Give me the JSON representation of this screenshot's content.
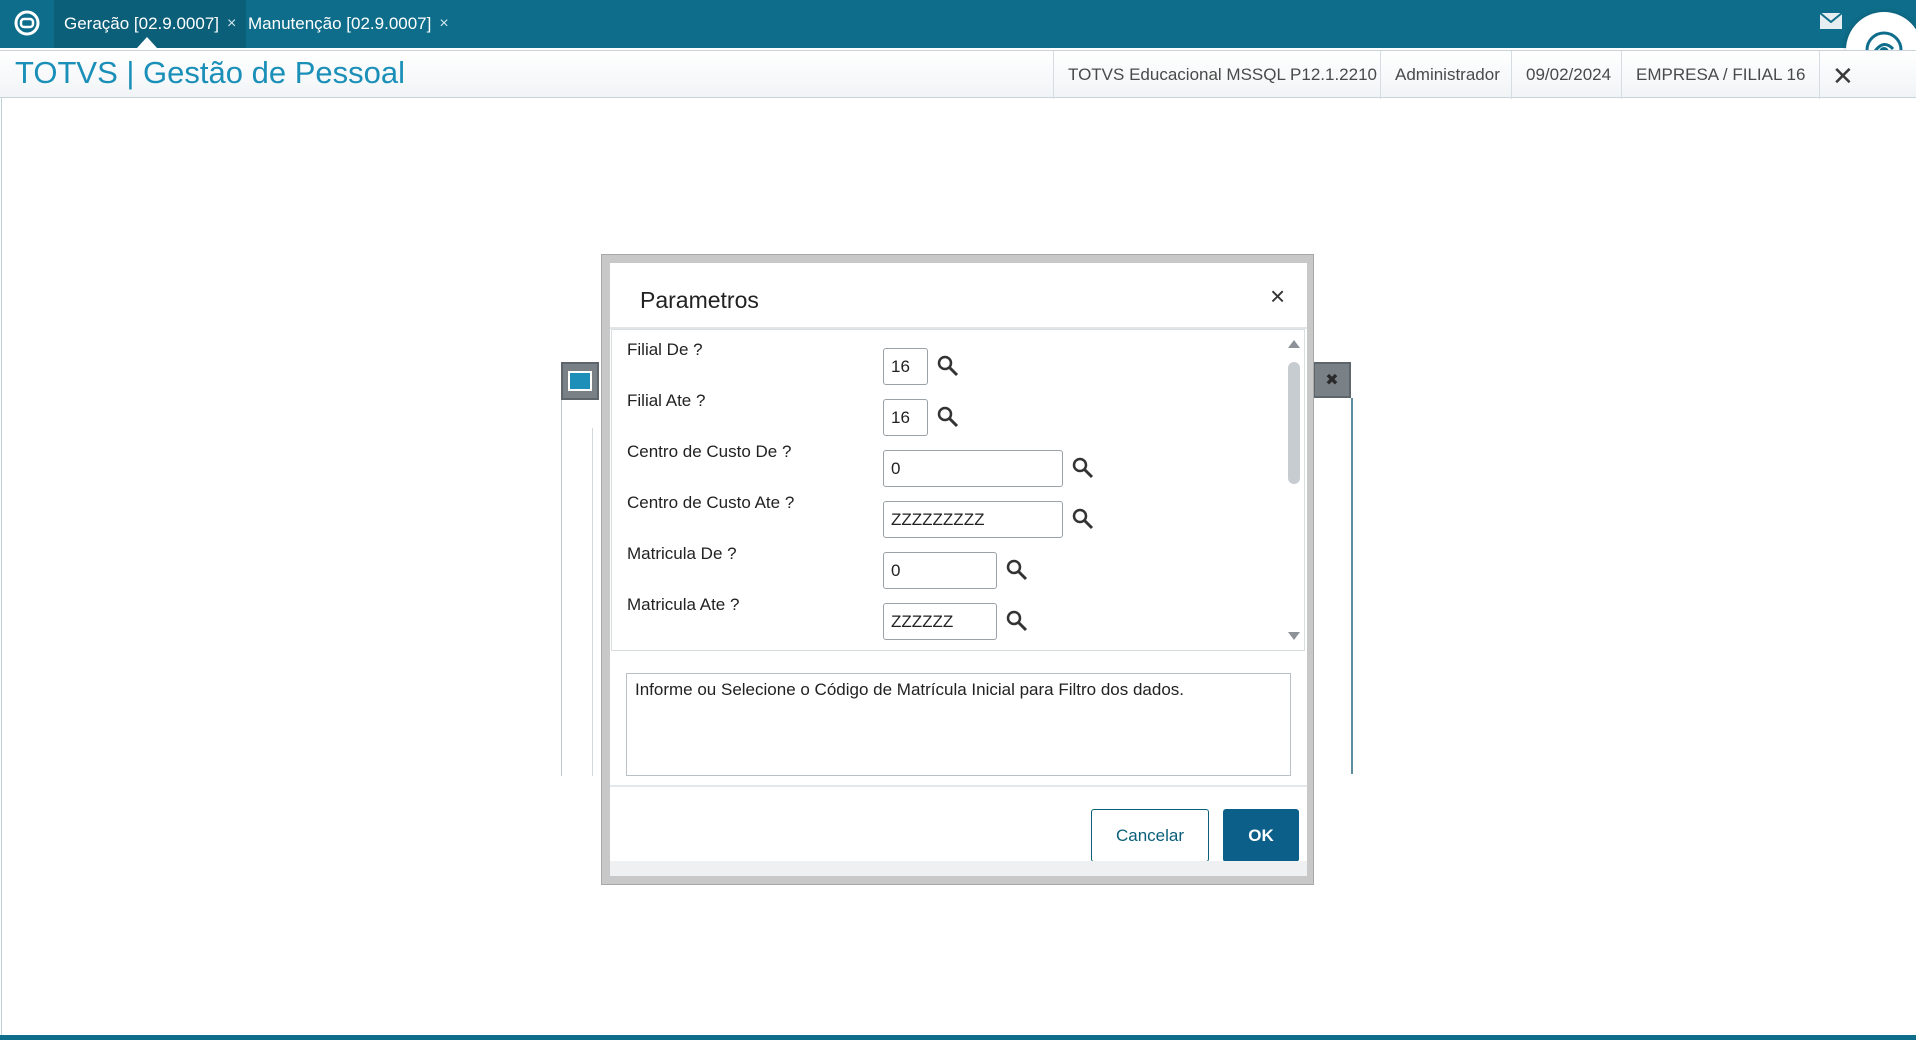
{
  "tabs": [
    {
      "label": "Geração [02.9.0007]",
      "close": "×"
    },
    {
      "label": "Manutenção [02.9.0007]",
      "close": "×"
    }
  ],
  "header": {
    "title": "TOTVS | Gestão de Pessoal",
    "environment": "TOTVS Educacional MSSQL P12.1.2210",
    "user": "Administrador",
    "date": "09/02/2024",
    "company": "EMPRESA / FILIAL 16",
    "close": "✕"
  },
  "dialog": {
    "title": "Parametros",
    "close": "×",
    "params": [
      {
        "label": "Filial De ?",
        "value": "16"
      },
      {
        "label": "Filial Ate ?",
        "value": "16"
      },
      {
        "label": "Centro de Custo De ?",
        "value": "0"
      },
      {
        "label": "Centro de Custo Ate ?",
        "value": "ZZZZZZZZZ"
      },
      {
        "label": "Matricula De ?",
        "value": "0"
      },
      {
        "label": "Matricula Ate ?",
        "value": "ZZZZZZ"
      }
    ],
    "help_text": "Informe ou Selecione o Código de Matrícula Inicial para Filtro dos dados.",
    "cancel_label": "Cancelar",
    "ok_label": "OK"
  },
  "colors": {
    "topbar": "#0e6d8a",
    "title": "#1a8fb8",
    "ok_button": "#0b5f89"
  }
}
